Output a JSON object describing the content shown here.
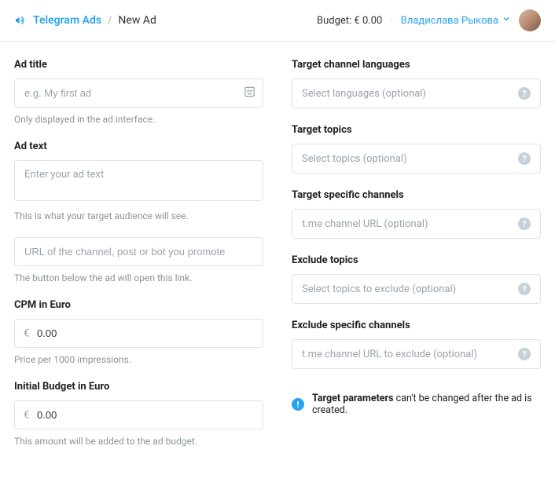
{
  "header": {
    "brand": "Telegram Ads",
    "sep": "/",
    "current": "New Ad",
    "budget_prefix": "Budget: € ",
    "budget_value": "0.00",
    "dot": "·",
    "username": "Владислава Рыкова"
  },
  "left": {
    "ad_title": {
      "label": "Ad title",
      "placeholder": "e.g. My first ad",
      "helper": "Only displayed in the ad interface."
    },
    "ad_text": {
      "label": "Ad text",
      "placeholder": "Enter your ad text",
      "helper": "This is what your target audience will see."
    },
    "promote_url": {
      "placeholder": "URL of the channel, post or bot you promote",
      "helper": "The button below the ad will open this link."
    },
    "cpm": {
      "label": "CPM in Euro",
      "symbol": "€",
      "value": "0.00",
      "helper": "Price per 1000 impressions."
    },
    "budget": {
      "label": "Initial Budget in Euro",
      "symbol": "€",
      "value": "0.00",
      "helper": "This amount will be added to the ad budget."
    }
  },
  "right": {
    "languages": {
      "label": "Target channel languages",
      "placeholder": "Select languages (optional)"
    },
    "topics": {
      "label": "Target topics",
      "placeholder": "Select topics (optional)"
    },
    "channels": {
      "label": "Target specific channels",
      "placeholder": "t.me channel URL (optional)"
    },
    "ex_topics": {
      "label": "Exclude topics",
      "placeholder": "Select topics to exclude (optional)"
    },
    "ex_channels": {
      "label": "Exclude specific channels",
      "placeholder": "t.me channel URL to exclude (optional)"
    },
    "notice_bold": "Target parameters",
    "notice_rest": " can't be changed after the ad is created."
  }
}
